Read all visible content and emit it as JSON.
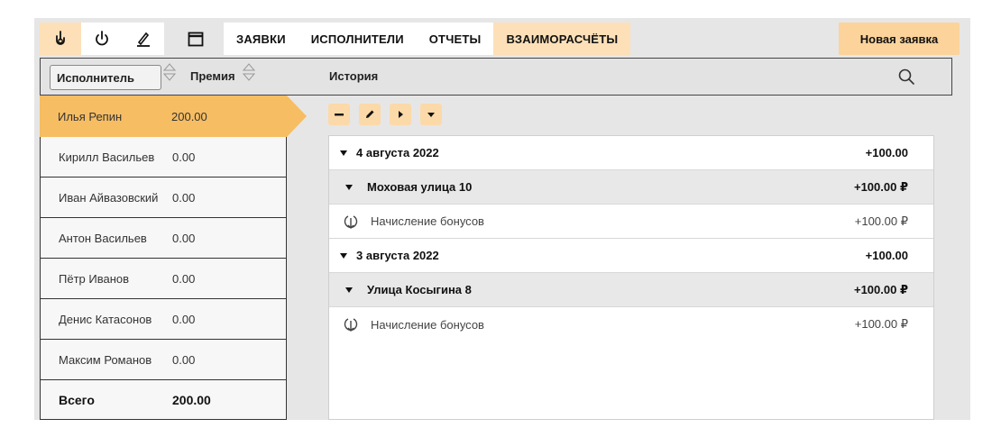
{
  "toolbar": {
    "icons": [
      "hand-pointer-icon",
      "power-icon",
      "pen-icon",
      "calendar-icon"
    ],
    "tabs": [
      {
        "label": "ЗАЯВКИ",
        "active": false
      },
      {
        "label": "ИСПОЛНИТЕЛИ",
        "active": false
      },
      {
        "label": "ОТЧЕТЫ",
        "active": false
      },
      {
        "label": "ВЗАИМОРАСЧЁТЫ",
        "active": true
      }
    ],
    "new_button": "Новая заявка"
  },
  "header": {
    "select_value": "Исполнитель",
    "premium_label": "Премия",
    "history_label": "История"
  },
  "executors": [
    {
      "name": "Илья Репин",
      "value": "200.00",
      "selected": true
    },
    {
      "name": "Кирилл Васильев",
      "value": "0.00"
    },
    {
      "name": "Иван Айвазовский",
      "value": "0.00"
    },
    {
      "name": "Антон Васильев",
      "value": "0.00"
    },
    {
      "name": "Пётр Иванов",
      "value": "0.00"
    },
    {
      "name": "Денис Катасонов",
      "value": "0.00"
    },
    {
      "name": "Максим Романов",
      "value": "0.00"
    }
  ],
  "total": {
    "label": "Всего",
    "value": "200.00"
  },
  "history": [
    {
      "type": "date",
      "label": "4 августа 2022",
      "amount": "+100.00"
    },
    {
      "type": "addr",
      "label": "Моховая улица 10",
      "amount": "+100.00 ₽"
    },
    {
      "type": "op",
      "label": "Начисление бонусов",
      "amount": "+100.00 ₽"
    },
    {
      "type": "date",
      "label": "3 августа 2022",
      "amount": "+100.00"
    },
    {
      "type": "addr",
      "label": "Улица Косыгина 8",
      "amount": "+100.00 ₽"
    },
    {
      "type": "op",
      "label": "Начисление бонусов",
      "amount": "+100.00 ₽"
    }
  ],
  "colors": {
    "accent": "#f6bd63",
    "accent_light": "#fde0b8",
    "button": "#fcd39a"
  }
}
